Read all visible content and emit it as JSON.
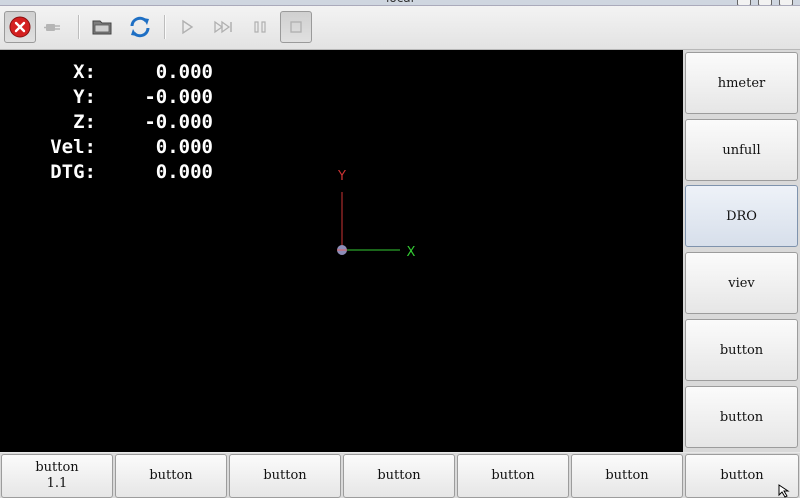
{
  "window": {
    "title": "local"
  },
  "toolbar": {
    "buttons": [
      {
        "icon": "estop-icon",
        "state": "pressed"
      },
      {
        "icon": "power-icon",
        "state": "disabled"
      },
      {
        "icon": "open-file-icon",
        "state": "normal"
      },
      {
        "icon": "reload-icon",
        "state": "normal"
      },
      {
        "icon": "run-icon",
        "state": "disabled"
      },
      {
        "icon": "step-icon",
        "state": "disabled"
      },
      {
        "icon": "pause-icon",
        "state": "disabled"
      },
      {
        "icon": "stop-icon",
        "state": "disabled"
      }
    ]
  },
  "dro": {
    "rows": [
      {
        "label": "X:",
        "value": "0.000"
      },
      {
        "label": "Y:",
        "value": "-0.000"
      },
      {
        "label": "Z:",
        "value": "-0.000"
      },
      {
        "label": "Vel:",
        "value": "0.000"
      },
      {
        "label": "DTG:",
        "value": "0.000"
      }
    ]
  },
  "preview": {
    "axis_x_label": "X",
    "axis_y_label": "Y",
    "colors": {
      "background": "#000000",
      "x_axis": "#33cc33",
      "y_axis": "#cc3333",
      "text": "#ffffff"
    }
  },
  "right_panel": {
    "buttons": [
      {
        "label": "hmeter",
        "active": false
      },
      {
        "label": "unfull",
        "active": false
      },
      {
        "label": "DRO",
        "active": true
      },
      {
        "label": "viev",
        "active": false
      },
      {
        "label": "button",
        "active": false
      },
      {
        "label": "button",
        "active": false
      }
    ]
  },
  "bottom_bar": {
    "buttons": [
      {
        "label": "button\n1.1"
      },
      {
        "label": "button"
      },
      {
        "label": "button"
      },
      {
        "label": "button"
      },
      {
        "label": "button"
      },
      {
        "label": "button"
      },
      {
        "label": "button"
      }
    ]
  }
}
